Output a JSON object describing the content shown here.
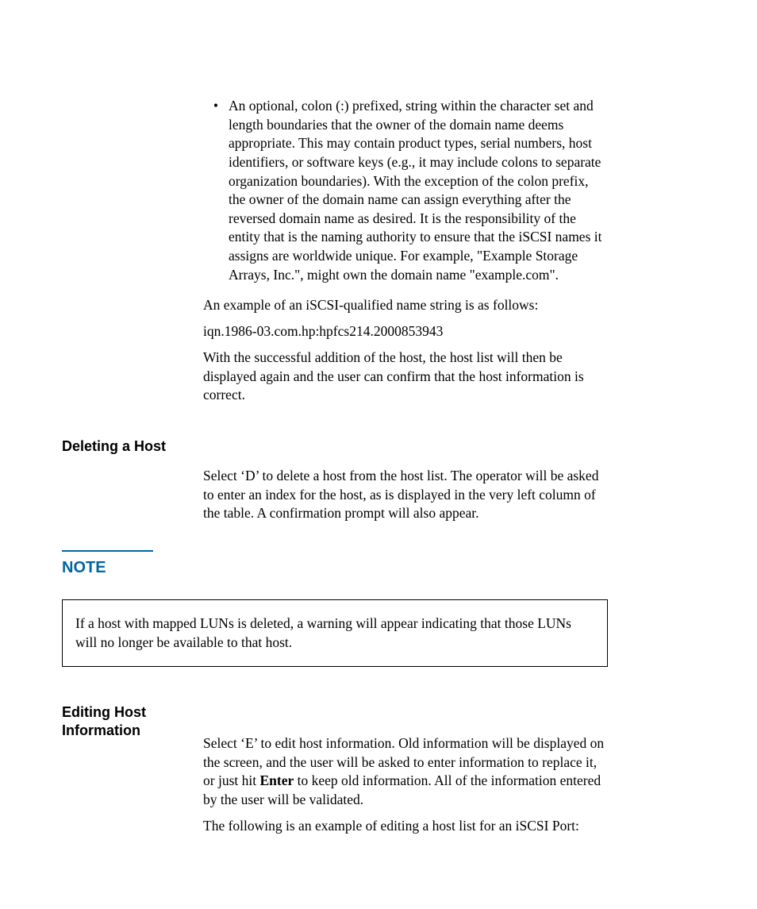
{
  "bullet": {
    "text": "An optional, colon (:) prefixed, string within the character set and length boundaries that the owner of the domain name deems appropriate. This may contain product types, serial numbers, host identifiers, or software keys (e.g., it may include colons to separate organization boundaries). With the exception of the colon prefix, the owner of the domain name can assign everything after the reversed domain name as desired. It is the responsibility of the entity that is the naming authority to ensure that the iSCSI names it assigns are worldwide unique. For example, \"Example Storage Arrays, Inc.\", might own the domain name \"example.com\"."
  },
  "para_example_intro": "An example of an iSCSI-qualified name string is as follows:",
  "para_example_value": "iqn.1986-03.com.hp:hpfcs214.2000853943",
  "para_success": "With the successful addition of the host, the host list will then be displayed again and the user can confirm that the host information is correct.",
  "section_delete": {
    "label": "Deleting a Host",
    "text": "Select ‘D’ to delete a host from the host list. The operator will be asked to enter an index for the host, as is displayed in the very left column of the table. A confirmation prompt will also appear."
  },
  "note": {
    "label": "NOTE",
    "text": "If a host with mapped LUNs is deleted, a warning will appear indicating that those LUNs will no longer be available to that host."
  },
  "section_edit": {
    "label": "Editing Host Information",
    "part1": "Select ‘E’ to edit host information. Old information will be displayed on the screen, and the user will be asked to enter information to replace it, or just hit ",
    "enter": "Enter",
    "part2": " to keep old information. All of the information entered by the user will be validated.",
    "closing": "The following is an example of editing a host list for an iSCSI Port:"
  }
}
